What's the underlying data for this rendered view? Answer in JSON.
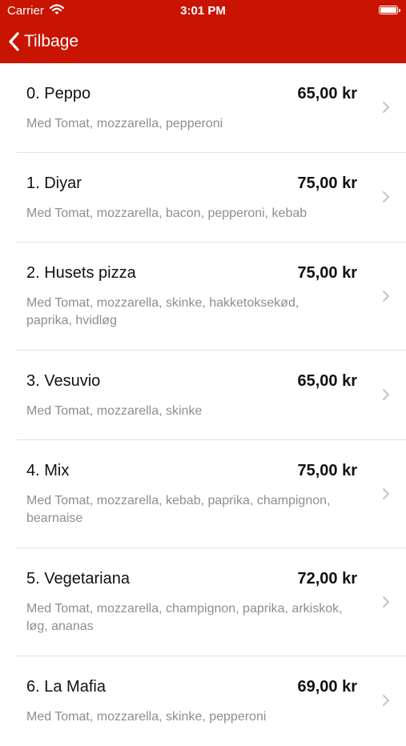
{
  "status_bar": {
    "carrier": "Carrier",
    "time": "3:01 PM",
    "wifi_icon": "wifi-icon",
    "battery_icon": "battery-icon"
  },
  "nav": {
    "back_label": "Tilbage",
    "back_icon": "chevron-left-icon",
    "bar_color": "#c81400"
  },
  "menu": [
    {
      "name": "0. Peppo",
      "price": "65,00 kr",
      "description": "Med Tomat, mozzarella, pepperoni"
    },
    {
      "name": "1. Diyar",
      "price": "75,00 kr",
      "description": "Med Tomat, mozzarella, bacon, pepperoni, kebab"
    },
    {
      "name": "2. Husets pizza",
      "price": "75,00 kr",
      "description": "Med Tomat, mozzarella, skinke, hakketoksekød, paprika, hvidløg"
    },
    {
      "name": "3. Vesuvio",
      "price": "65,00 kr",
      "description": "Med Tomat, mozzarella, skinke"
    },
    {
      "name": "4. Mix",
      "price": "75,00 kr",
      "description": "Med Tomat, mozzarella, kebab, paprika, champignon, bearnaise"
    },
    {
      "name": "5. Vegetariana",
      "price": "72,00 kr",
      "description": "Med Tomat, mozzarella, champignon, paprika, arkiskok, løg, ananas"
    },
    {
      "name": "6. La Mafia",
      "price": "69,00 kr",
      "description": "Med Tomat, mozzarella, skinke, pepperoni"
    }
  ]
}
